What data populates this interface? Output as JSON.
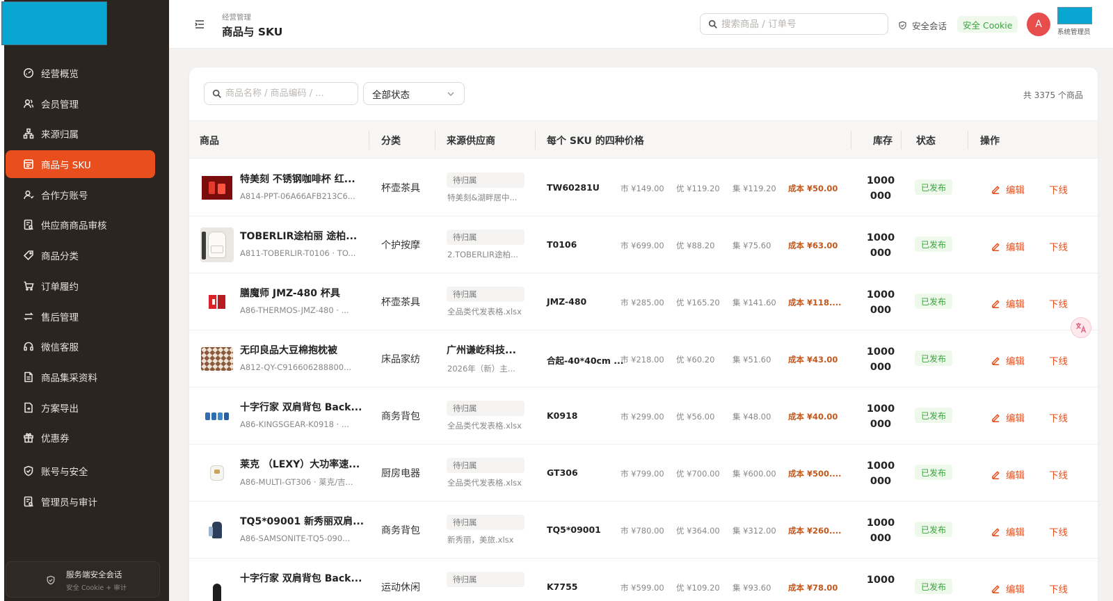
{
  "sidebar": {
    "items": [
      {
        "label": "经营概览",
        "icon": "dashboard-icon"
      },
      {
        "label": "会员管理",
        "icon": "members-icon"
      },
      {
        "label": "来源归属",
        "icon": "source-tree-icon"
      },
      {
        "label": "商品与 SKU",
        "icon": "product-sku-icon"
      },
      {
        "label": "合作方账号",
        "icon": "partner-account-icon"
      },
      {
        "label": "供应商商品审核",
        "icon": "supplier-review-icon"
      },
      {
        "label": "商品分类",
        "icon": "tag-icon"
      },
      {
        "label": "订单履约",
        "icon": "cart-icon"
      },
      {
        "label": "售后管理",
        "icon": "return-icon"
      },
      {
        "label": "微信客服",
        "icon": "headset-icon"
      },
      {
        "label": "商品集采资料",
        "icon": "document-icon"
      },
      {
        "label": "方案导出",
        "icon": "export-icon"
      },
      {
        "label": "优惠券",
        "icon": "gift-icon"
      },
      {
        "label": "账号与安全",
        "icon": "shield-icon"
      },
      {
        "label": "管理员与审计",
        "icon": "audit-icon"
      }
    ],
    "session": {
      "title": "服务端安全会话",
      "subtitle": "安全 Cookie + 审计"
    }
  },
  "header": {
    "breadcrumb_parent": "经营管理",
    "title": "商品与 SKU",
    "search_placeholder": "搜索商品 / 订单号",
    "secure_session": "安全会话",
    "cookie_badge": "安全 Cookie",
    "avatar_letter": "A",
    "user_role": "系统管理员"
  },
  "filters": {
    "search_placeholder": "商品名称 / 商品编码 / ...",
    "status_select": "全部状态",
    "total": "共 3375 个商品"
  },
  "table": {
    "columns": [
      "商品",
      "分类",
      "来源供应商",
      "每个 SKU 的四种价格",
      "库存",
      "状态",
      "操作"
    ],
    "rows": [
      {
        "name": "特美刻 不锈钢咖啡杯 红...",
        "code": "A814-PPT-06A66AFB213C6...",
        "category": "杯壶茶具",
        "supplier_badge": "待归属",
        "supplier_name": "",
        "supplier_file": "特美刻&湖畔居中...",
        "sku": "TW60281U",
        "market": "市 ¥149.00",
        "member": "优 ¥119.20",
        "group": "集 ¥119.20",
        "cost": "成本 ¥50.00",
        "stock_line1": "1000",
        "stock_line2": "000",
        "status": "已发布",
        "edit": "编辑",
        "offline": "下线",
        "thumb": "red-cup-thumb"
      },
      {
        "name": "TOBERLIR途柏丽 途柏...",
        "code": "A811-TOBERLIR-T0106 · TO...",
        "category": "个护按摩",
        "supplier_badge": "待归属",
        "supplier_name": "",
        "supplier_file": "2.TOBERLIR途柏...",
        "sku": "T0106",
        "market": "市 ¥699.00",
        "member": "优 ¥88.20",
        "group": "集 ¥75.60",
        "cost": "成本 ¥63.00",
        "stock_line1": "1000",
        "stock_line2": "000",
        "status": "已发布",
        "edit": "编辑",
        "offline": "下线",
        "thumb": "backpack-white-thumb"
      },
      {
        "name": "膳魔师 JMZ-480 杯具",
        "code": "A86-THERMOS-JMZ-480 · ...",
        "category": "杯壶茶具",
        "supplier_badge": "待归属",
        "supplier_name": "",
        "supplier_file": "全品类代发表格.xlsx",
        "sku": "JMZ-480",
        "market": "市 ¥285.00",
        "member": "优 ¥165.20",
        "group": "集 ¥141.60",
        "cost": "成本 ¥118....",
        "stock_line1": "1000",
        "stock_line2": "000",
        "status": "已发布",
        "edit": "编辑",
        "offline": "下线",
        "thumb": "red-thermos-thumb"
      },
      {
        "name": "无印良品大豆棉抱枕被",
        "code": "A812-QY-C916606288800...",
        "category": "床品家纺",
        "supplier_badge": "",
        "supplier_name": "广州谦屹科技...",
        "supplier_file": "2026年（新）主...",
        "sku": "合起-40*40cm ...",
        "market": "市 ¥218.00",
        "member": "优 ¥60.20",
        "group": "集 ¥51.60",
        "cost": "成本 ¥43.00",
        "stock_line1": "1000",
        "stock_line2": "000",
        "status": "已发布",
        "edit": "编辑",
        "offline": "下线",
        "thumb": "checker-pillow-thumb"
      },
      {
        "name": "十字行家 双肩背包 Back...",
        "code": "A86-KINGSGEAR-K0918 · ...",
        "category": "商务背包",
        "supplier_badge": "待归属",
        "supplier_name": "",
        "supplier_file": "全品类代发表格.xlsx",
        "sku": "K0918",
        "market": "市 ¥299.00",
        "member": "优 ¥56.00",
        "group": "集 ¥48.00",
        "cost": "成本 ¥40.00",
        "stock_line1": "1000",
        "stock_line2": "000",
        "status": "已发布",
        "edit": "编辑",
        "offline": "下线",
        "thumb": "blue-bags-thumb"
      },
      {
        "name": "莱克 （LEXY）大功率速...",
        "code": "A86-MULTI-GT306 · 莱克/吉...",
        "category": "厨房电器",
        "supplier_badge": "待归属",
        "supplier_name": "",
        "supplier_file": "全品类代发表格.xlsx",
        "sku": "GT306",
        "market": "市 ¥799.00",
        "member": "优 ¥700.00",
        "group": "集 ¥600.00",
        "cost": "成本 ¥500....",
        "stock_line1": "1000",
        "stock_line2": "000",
        "status": "已发布",
        "edit": "编辑",
        "offline": "下线",
        "thumb": "white-appliance-thumb"
      },
      {
        "name": "TQ5*09001 新秀丽双肩...",
        "code": "A86-SAMSONITE-TQ5-090...",
        "category": "商务背包",
        "supplier_badge": "待归属",
        "supplier_name": "",
        "supplier_file": "新秀丽，美旅.xlsx",
        "sku": "TQ5*09001",
        "market": "市 ¥780.00",
        "member": "优 ¥364.00",
        "group": "集 ¥312.00",
        "cost": "成本 ¥260....",
        "stock_line1": "1000",
        "stock_line2": "000",
        "status": "已发布",
        "edit": "编辑",
        "offline": "下线",
        "thumb": "navy-backpack-thumb"
      },
      {
        "name": "十字行家 双肩背包 Back...",
        "code": "",
        "category": "运动休闲",
        "supplier_badge": "待归属",
        "supplier_name": "",
        "supplier_file": "",
        "sku": "K7755",
        "market": "市 ¥599.00",
        "member": "优 ¥109.20",
        "group": "集 ¥93.60",
        "cost": "成本 ¥78.00",
        "stock_line1": "1000",
        "stock_line2": "",
        "status": "已发布",
        "edit": "编辑",
        "offline": "下线",
        "thumb": "black-backpack-thumb"
      }
    ]
  },
  "colors": {
    "accent": "#e84f1c",
    "sidebar_bg": "#2b2522",
    "published_green": "#3aa33d",
    "cost_brown": "#c4571c",
    "logo_block": "#0aa6d2"
  }
}
